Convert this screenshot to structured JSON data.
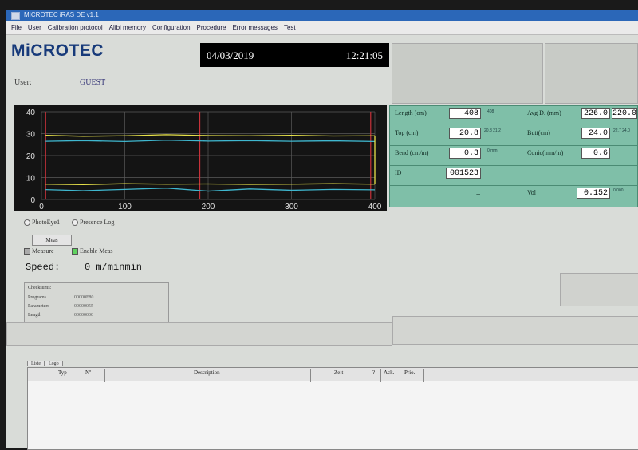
{
  "window": {
    "title": "MICROTEC iRAS DE v1.1"
  },
  "menu": {
    "items": [
      "File",
      "User",
      "Calibration protocol",
      "Alibi memory",
      "Configuration",
      "Procedure",
      "Error messages",
      "Test"
    ]
  },
  "logo": "MiCROTEC",
  "header": {
    "date": "04/03/2019",
    "time": "12:21:05"
  },
  "user": {
    "label": "User:",
    "value": "GUEST"
  },
  "chart_data": {
    "type": "line",
    "x_ticks": [
      "0",
      "100",
      "200",
      "300",
      "400"
    ],
    "y_ticks": [
      "0",
      "10",
      "20",
      "30",
      "40"
    ],
    "xlim": [
      0,
      400
    ],
    "ylim": [
      0,
      40
    ],
    "grid": true,
    "series": [
      {
        "color": "#e8e24a",
        "x": [
          5,
          50,
          100,
          150,
          200,
          250,
          300,
          350,
          400
        ],
        "y": [
          29.2,
          28.8,
          29.0,
          29.5,
          29.1,
          29.0,
          29.2,
          28.9,
          29.0
        ]
      },
      {
        "color": "#3fb7cf",
        "x": [
          5,
          50,
          100,
          150,
          200,
          250,
          300,
          350,
          400
        ],
        "y": [
          26.5,
          26.8,
          26.4,
          27.0,
          26.6,
          26.8,
          26.5,
          26.7,
          26.4
        ]
      },
      {
        "color": "#e8e24a",
        "x": [
          5,
          50,
          100,
          150,
          200,
          250,
          300,
          350,
          400
        ],
        "y": [
          7.0,
          6.8,
          7.2,
          7.0,
          7.1,
          6.9,
          7.0,
          7.2,
          7.0
        ]
      },
      {
        "color": "#3fb7cf",
        "x": [
          5,
          50,
          100,
          150,
          200,
          250,
          300,
          350,
          400
        ],
        "y": [
          4.5,
          4.0,
          4.6,
          5.2,
          3.8,
          4.8,
          4.2,
          4.6,
          4.4
        ]
      }
    ],
    "markers": [
      5,
      190,
      395
    ],
    "end_line": 400
  },
  "measurements": {
    "length": {
      "label": "Length (cm)",
      "value": "408",
      "sub": "408"
    },
    "avg_d": {
      "label": "Avg D. (mm)",
      "v1": "226.0",
      "v2": "220.0"
    },
    "top": {
      "label": "Top (cm)",
      "value": "20.8",
      "sub": "20.8 21.2"
    },
    "butt": {
      "label": "Butt(cm)",
      "value": "24.0",
      "sub": "22.7 24.0"
    },
    "bend": {
      "label": "Bend (cm/m)",
      "value": "0.3",
      "sub": "0 mm"
    },
    "conic": {
      "label": "Conic(mm/m)",
      "value": "0.6"
    },
    "id": {
      "label": "ID",
      "value": "001523"
    },
    "dash": "--",
    "vol": {
      "label": "Vol",
      "value": "0.152",
      "sub": "0.000"
    }
  },
  "options": {
    "photoeye": "PhotoEye1",
    "presence": "Presence Log",
    "meas_button": "Meas",
    "measure": "Measure",
    "enable": "Enable Meas"
  },
  "speed": {
    "label": "Speed:",
    "value": "0 m/minmin"
  },
  "checksums": {
    "title": "Checksums:",
    "rows": [
      {
        "label": "Programs",
        "value": "00000F80"
      },
      {
        "label": "Parameters",
        "value": "00000055"
      },
      {
        "label": "Length",
        "value": "00000000"
      }
    ]
  },
  "table": {
    "tabs": [
      "Liste",
      "Logo"
    ],
    "headers": [
      "Typ",
      "Nº",
      "Description",
      "Zeit",
      "?",
      "Ack.",
      "Prio."
    ]
  }
}
